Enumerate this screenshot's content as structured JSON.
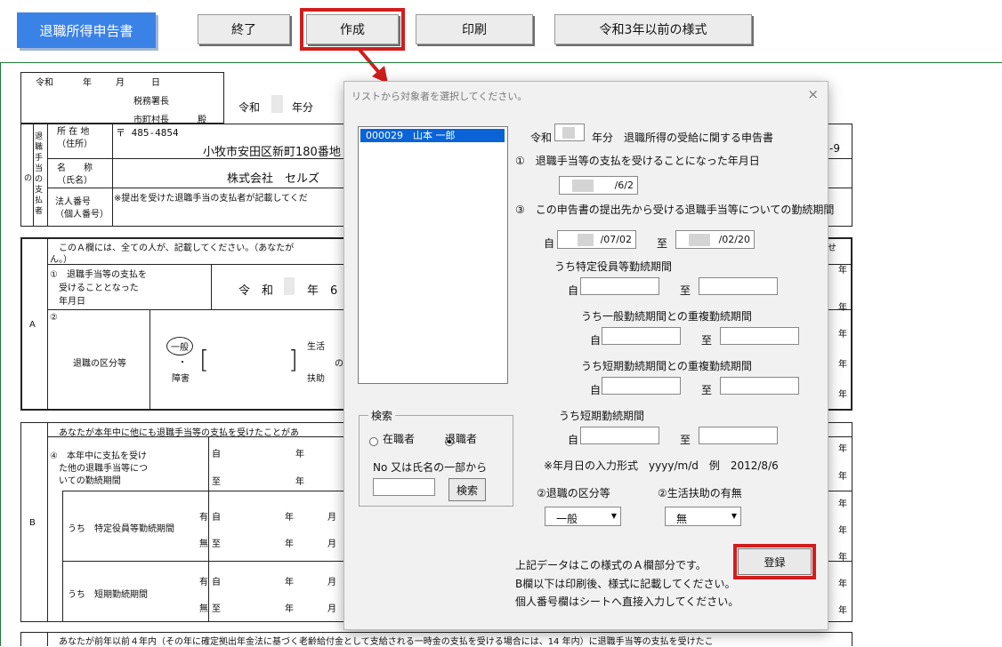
{
  "toolbar": {
    "title": "退職所得申告書",
    "quit": "終了",
    "create": "作成",
    "print": "印刷",
    "old_format": "令和3年以前の様式"
  },
  "sheet": {
    "date_row": [
      "令和",
      "年",
      "月",
      "日"
    ],
    "tax_office": "税務署長",
    "mayor": "市町村長",
    "dono": "殿",
    "reiwa_year": [
      "令和",
      "年分"
    ],
    "payer_vertical": "退職手当の支払者",
    "payer_no": "の",
    "address_label": "所 在 地\n（住所）",
    "postal": "〒 485-4854",
    "address": "小牧市安田区新町180番地",
    "address_tail": "-9",
    "name_label": "名　　称\n（氏名）",
    "company": "株式会社　セルズ",
    "corp_no_label": "法人番号\n（個人番号）",
    "corp_no_note": "※提出を受けた退職手当の支払者が記載してくだ",
    "secA_note": "このＡ欄には、全ての人が、記載してください。（あなたが",
    "secA_note2": "ん。）",
    "secA_note_tail": "せ",
    "sec_A": "A",
    "a1_label": "①　退職手当等の支払を\n　受けることとなった\n　年月日",
    "a1_value": "令　和",
    "a1_year": "年　6",
    "a2_label": "②",
    "kubun": "退職の区分等",
    "ippan": "一般",
    "dot": "・",
    "shougai": "障害",
    "seikatsu": "生活",
    "fujo": "扶助",
    "no": "の",
    "sec_B": "B",
    "secB_note": "あなたが本年中に他にも退職手当等の支払を受けたことがあ",
    "b4_label": "④　本年中に支払を受け\n　た他の退職手当等につ\n　いての勤続期間",
    "ji": "自",
    "itaru": "至",
    "nen": "年",
    "tsuki": "月",
    "yu": "有",
    "mu": "無",
    "b_tokutei": "うち　特定役員等勤続期間",
    "b_tanki": "うち　短期勤続期間",
    "bottom_note": "あなたが前年以前４年内（その年に確定拠出年金法に基づく老齢給付金として支給される一時金の支払を受ける場合には、14 年内）に退職手当等の支払を受けたこ"
  },
  "dialog": {
    "title": "リストから対象者を選択してください。",
    "close": "×",
    "list_selected": "000029　山本 一郎",
    "header_reiwa": "令和",
    "header_tail": "年分　退職所得の受給に関する申告書",
    "q1": "①　退職手当等の支払を受けることになった年月日",
    "q1_value": "/6/2",
    "q3": "③　この申告書の提出先から受ける退職手当等についての勤続期間",
    "ji": "自",
    "itaru": "至",
    "q3_from": "/07/02",
    "q3_to": "/02/20",
    "tokutei": "うち特定役員等勤続期間",
    "ippan_overlap": "うち一般勤続期間との重複勤続期間",
    "tanki_overlap": "うち短期勤続期間との重複勤続期間",
    "tanki": "うち短期勤続期間",
    "format_note": "※年月日の入力形式　yyyy/m/d　例　2012/8/6",
    "search_group": "検索",
    "radio_current": "在職者",
    "radio_retired": "退職者",
    "search_hint": "No 又は氏名の一部から",
    "search_button": "検索",
    "kubun_label": "②退職の区分等",
    "fujo_label": "②生活扶助の有無",
    "kubun_value": "一般",
    "fujo_value": "無",
    "register": "登録",
    "footer1": "上記データはこの様式のＡ欄部分です。",
    "footer2": "B欄以下は印刷後、様式に記載してください。",
    "footer3": "個人番号欄はシートへ直接入力してください。"
  },
  "colors": {
    "title_bg": "#3b82e6",
    "highlight": "#d11d1d",
    "selection": "#0a64d8",
    "rule": "#1e7a3a"
  }
}
